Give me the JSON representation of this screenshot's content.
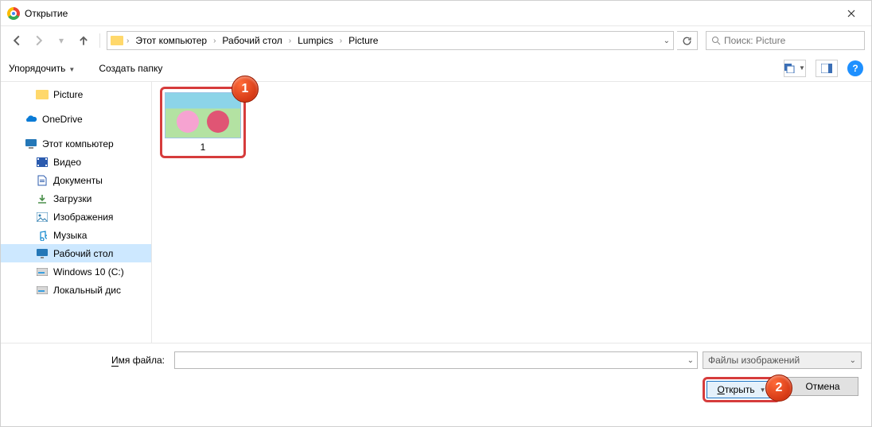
{
  "title": "Открытие",
  "breadcrumbs": [
    "Этот компьютер",
    "Рабочий стол",
    "Lumpics",
    "Picture"
  ],
  "search": {
    "placeholder": "Поиск: Picture"
  },
  "toolbar": {
    "organize": "Упорядочить",
    "new_folder": "Создать папку"
  },
  "tree": {
    "picture": "Picture",
    "onedrive": "OneDrive",
    "this_pc": "Этот компьютер",
    "video": "Видео",
    "documents": "Документы",
    "downloads": "Загрузки",
    "images": "Изображения",
    "music": "Музыка",
    "desktop": "Рабочий стол",
    "drive_c": "Windows 10 (C:)",
    "drive_local": "Локальный дис"
  },
  "file": {
    "name": "1"
  },
  "bottom": {
    "filename_label_u": "И",
    "filename_label_rest": "мя файла:",
    "filter": "Файлы изображений",
    "open": "О",
    "open_rest": "ткрыть",
    "cancel": "Отмена"
  },
  "callouts": {
    "one": "1",
    "two": "2"
  }
}
